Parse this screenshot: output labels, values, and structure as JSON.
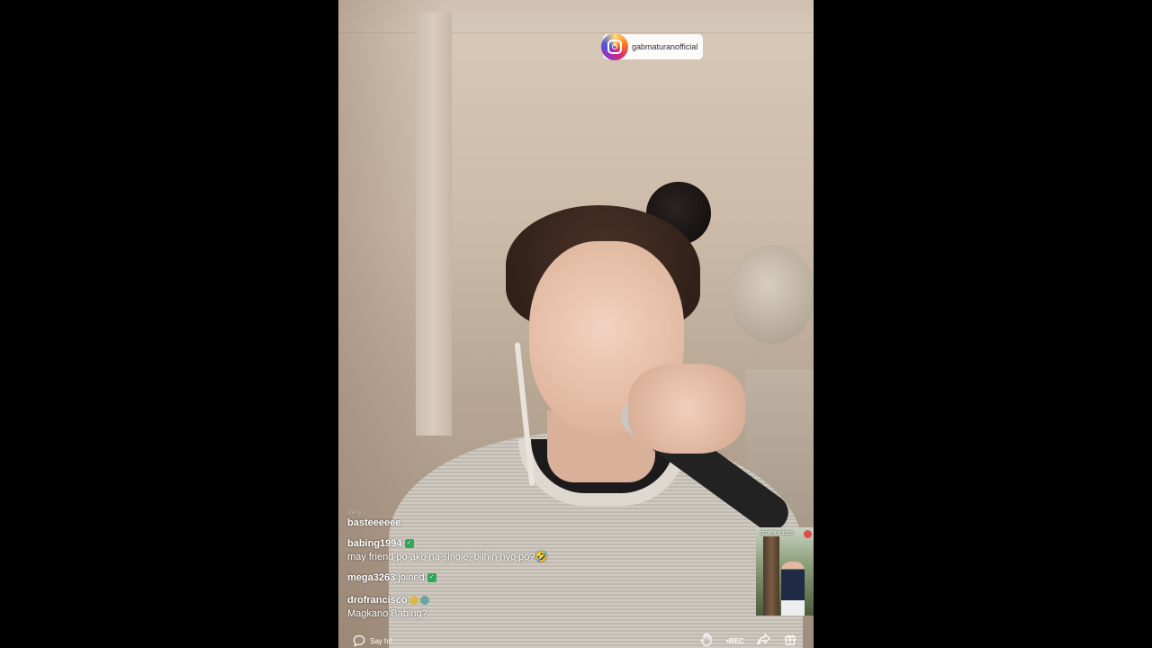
{
  "overlay": {
    "instagram_handle": "gabmaturanofficial",
    "instagram_icon": "instagram-icon"
  },
  "chat": {
    "faded_previous": "tarry...",
    "messages": [
      {
        "id": "m1",
        "user": "",
        "text": "basteeeeee"
      },
      {
        "id": "m2",
        "user": "babing1994",
        "text": "may friend po ako na single, bilhin nyo po?🤣"
      },
      {
        "id": "m3",
        "user": "mega3263",
        "text": "joined"
      },
      {
        "id": "m4",
        "user": "drofrancisco",
        "text": "Magkano Babing?"
      }
    ]
  },
  "guest": {
    "name": "drofrancisco"
  },
  "bottom_bar": {
    "comment_placeholder": "Say hi!",
    "rec_label": "•REC",
    "icons": [
      "comment-icon",
      "raise-hand-icon",
      "share-icon",
      "gift-icon"
    ]
  },
  "colors": {
    "background": "#000000",
    "verified_badge": "#2eaa5a",
    "live_dot": "#e34a4a"
  }
}
